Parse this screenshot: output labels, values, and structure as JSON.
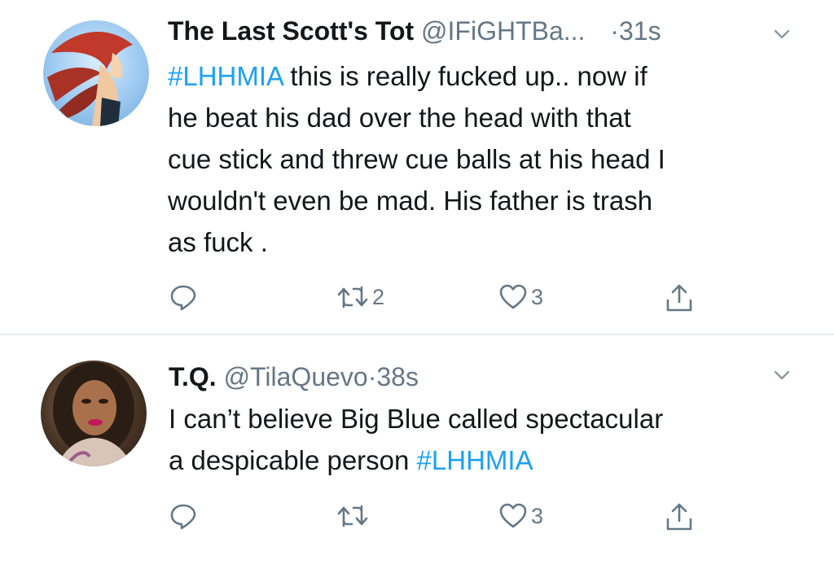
{
  "tweets": [
    {
      "name": "The Last Scott's Tot",
      "handle": "@IFiGHTBa...",
      "dot": "·",
      "time": "31s",
      "hashtag": "#LHHMIA",
      "text_lines": [
        " this is really fucked up.. now if",
        "he beat his dad over the head with that",
        "cue stick and threw cue balls at his head I",
        "wouldn't even be mad.   His father is trash",
        "as fuck ."
      ],
      "retweets": "2",
      "likes": "3"
    },
    {
      "name": "T.Q.",
      "handle": "@TilaQuevo",
      "dot": "·",
      "time": "38s",
      "text_lines": [
        "I can’t believe Big Blue called spectacular",
        "a despicable person "
      ],
      "hashtag": "#LHHMIA",
      "retweets": "",
      "likes": "3"
    }
  ],
  "icons": {
    "reply": "reply-icon",
    "retweet": "retweet-icon",
    "like": "heart-icon",
    "share": "share-icon",
    "menu": "chevron-down-icon"
  },
  "colors": {
    "text": "#14171a",
    "secondary": "#657786",
    "link": "#1da1f2",
    "divider": "#e6ecf0"
  }
}
